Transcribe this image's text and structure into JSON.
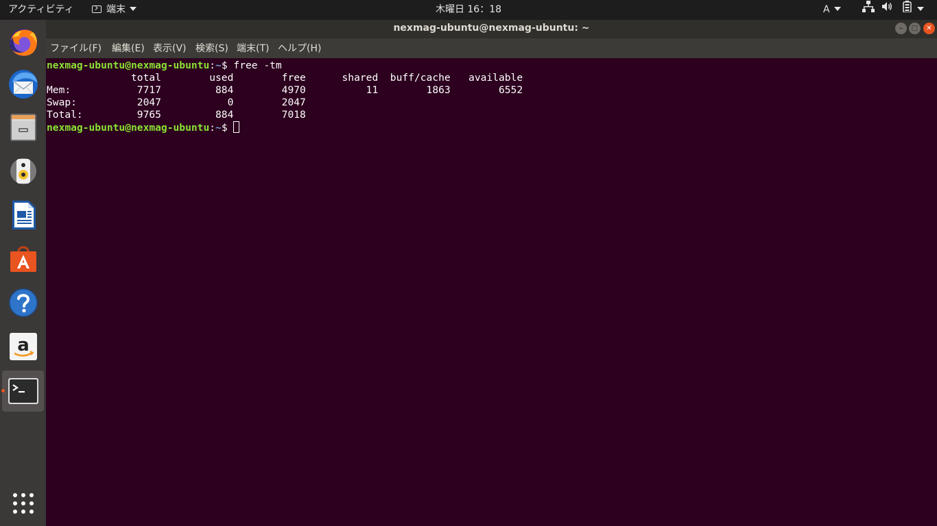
{
  "topbar": {
    "activities": "アクティビティ",
    "app_menu": "端末",
    "clock": "木曜日 16：18",
    "input_method": "A"
  },
  "dock": {
    "items": [
      {
        "name": "firefox",
        "icon": "firefox-icon"
      },
      {
        "name": "thunderbird",
        "icon": "thunderbird-icon"
      },
      {
        "name": "files",
        "icon": "files-icon"
      },
      {
        "name": "rhythmbox",
        "icon": "speaker-icon"
      },
      {
        "name": "libreoffice-writer",
        "icon": "writer-icon"
      },
      {
        "name": "software",
        "icon": "software-bag-icon"
      },
      {
        "name": "help",
        "icon": "help-icon"
      },
      {
        "name": "amazon",
        "icon": "amazon-icon"
      },
      {
        "name": "terminal",
        "icon": "terminal-icon",
        "active": true
      }
    ],
    "show_apps_icon": "app-grid-icon"
  },
  "window": {
    "title": "nexmag-ubuntu@nexmag-ubuntu: ~",
    "menu": [
      "ファイル(F)",
      "編集(E)",
      "表示(V)",
      "検索(S)",
      "端末(T)",
      "ヘルプ(H)"
    ]
  },
  "terminal": {
    "prompt_user": "nexmag-ubuntu@nexmag-ubuntu",
    "prompt_colon": ":",
    "prompt_path": "~",
    "prompt_symbol": "$ ",
    "command": "free -tm",
    "output": [
      "              total        used        free      shared  buff/cache   available",
      "Mem:           7717         884        4970          11        1863        6552",
      "Swap:          2047           0        2047",
      "Total:         9765         884        7018"
    ]
  },
  "colors": {
    "terminal_bg": "#2c001e",
    "prompt_user": "#8ae234",
    "prompt_path": "#729fcf",
    "accent": "#e95420"
  }
}
